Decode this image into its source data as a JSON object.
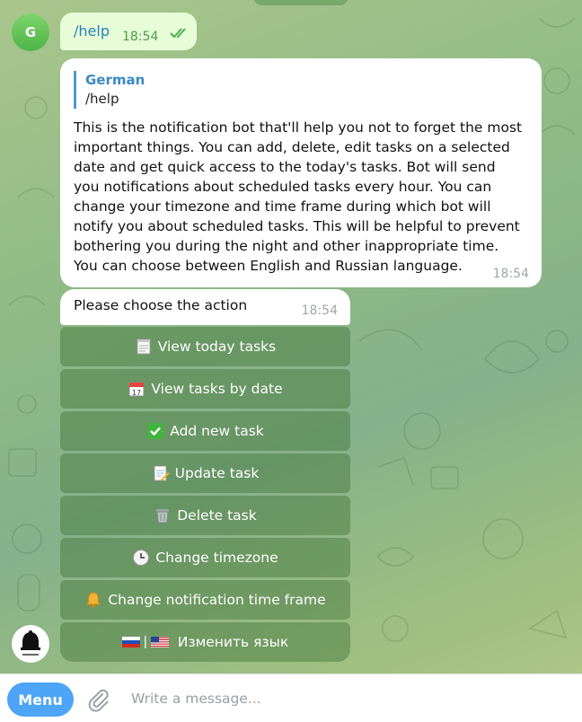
{
  "user": {
    "avatar_letter": "G"
  },
  "outgoing": {
    "text": "/help",
    "time": "18:54"
  },
  "help_message": {
    "reply_to_name": "German",
    "reply_to_text": "/help",
    "body": "This is the notification bot that'll help you not to forget the most important things. You can add, delete, edit tasks on a selected date and get quick access to the today's tasks. Bot will send you notifications about scheduled tasks every hour. You can change your timezone and time frame during which bot will notify you about scheduled tasks. This will be helpful to prevent bothering you during the night and other inappropriate time. You can choose between English and Russian language.",
    "time": "18:54"
  },
  "action_prompt": {
    "text": "Please choose the action",
    "time": "18:54"
  },
  "keyboard": [
    {
      "icon": "notepad-icon",
      "label": "View today tasks"
    },
    {
      "icon": "calendar-icon",
      "label": "View tasks by date"
    },
    {
      "icon": "check-mark-icon",
      "label": "Add new task"
    },
    {
      "icon": "memo-icon",
      "label": "Update task"
    },
    {
      "icon": "trash-icon",
      "label": "Delete task"
    },
    {
      "icon": "clock-icon",
      "label": "Change timezone"
    },
    {
      "icon": "bell-icon",
      "label": "Change notification time frame"
    },
    {
      "icon": "flags-icon",
      "label": "Изменить язык"
    }
  ],
  "composer": {
    "menu_label": "Menu",
    "placeholder": "Write a message..."
  },
  "colors": {
    "accent": "#4ea4f6",
    "outgoing_bubble": "#e6fdd8",
    "keyboard_button": "#5c8a4e"
  }
}
